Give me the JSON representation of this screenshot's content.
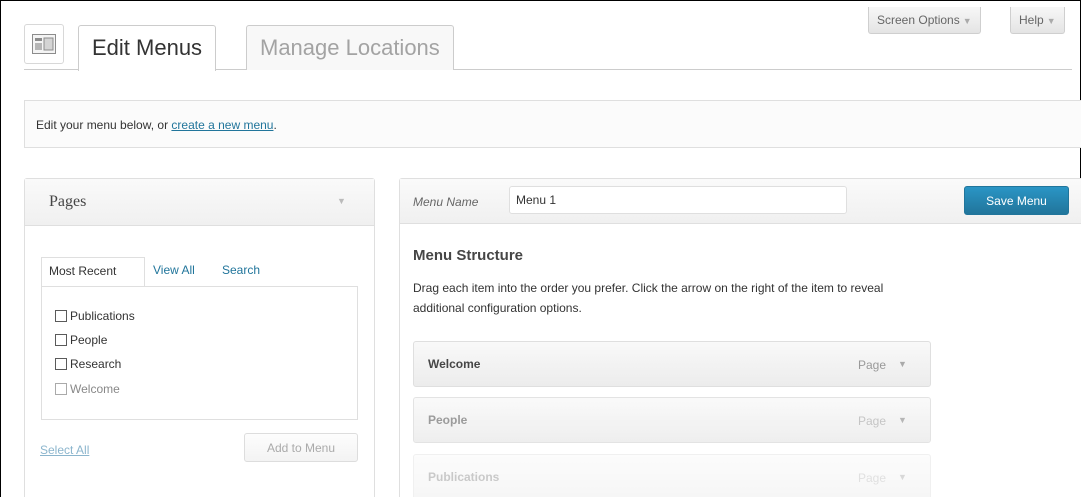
{
  "header": {
    "screen_options_label": "Screen Options",
    "help_label": "Help",
    "tabs": [
      {
        "label": "Edit Menus",
        "active": true
      },
      {
        "label": "Manage Locations",
        "active": false
      }
    ]
  },
  "manage": {
    "text": "Edit your menu below, or",
    "link": "create a new menu",
    "suffix": "."
  },
  "pages_panel": {
    "title": "Pages",
    "tabs": [
      "Most Recent",
      "View All",
      "Search"
    ],
    "items": [
      "Publications",
      "People",
      "Research",
      "Welcome"
    ],
    "select_all": "Select All",
    "add_button": "Add to Menu"
  },
  "menu_panel": {
    "name_label": "Menu Name",
    "name_value": "Menu 1",
    "save_button": "Save Menu",
    "structure_title": "Menu Structure",
    "structure_desc_line1": "Drag each item into the order you prefer. Click the arrow on the right of the item to reveal",
    "structure_desc_line2": "additional configuration options.",
    "items": [
      {
        "title": "Welcome",
        "type": "Page"
      },
      {
        "title": "People",
        "type": "Page"
      },
      {
        "title": "Publications",
        "type": "Page"
      }
    ]
  },
  "colors": {
    "link": "#21759b",
    "primary_button": "#21759b"
  }
}
